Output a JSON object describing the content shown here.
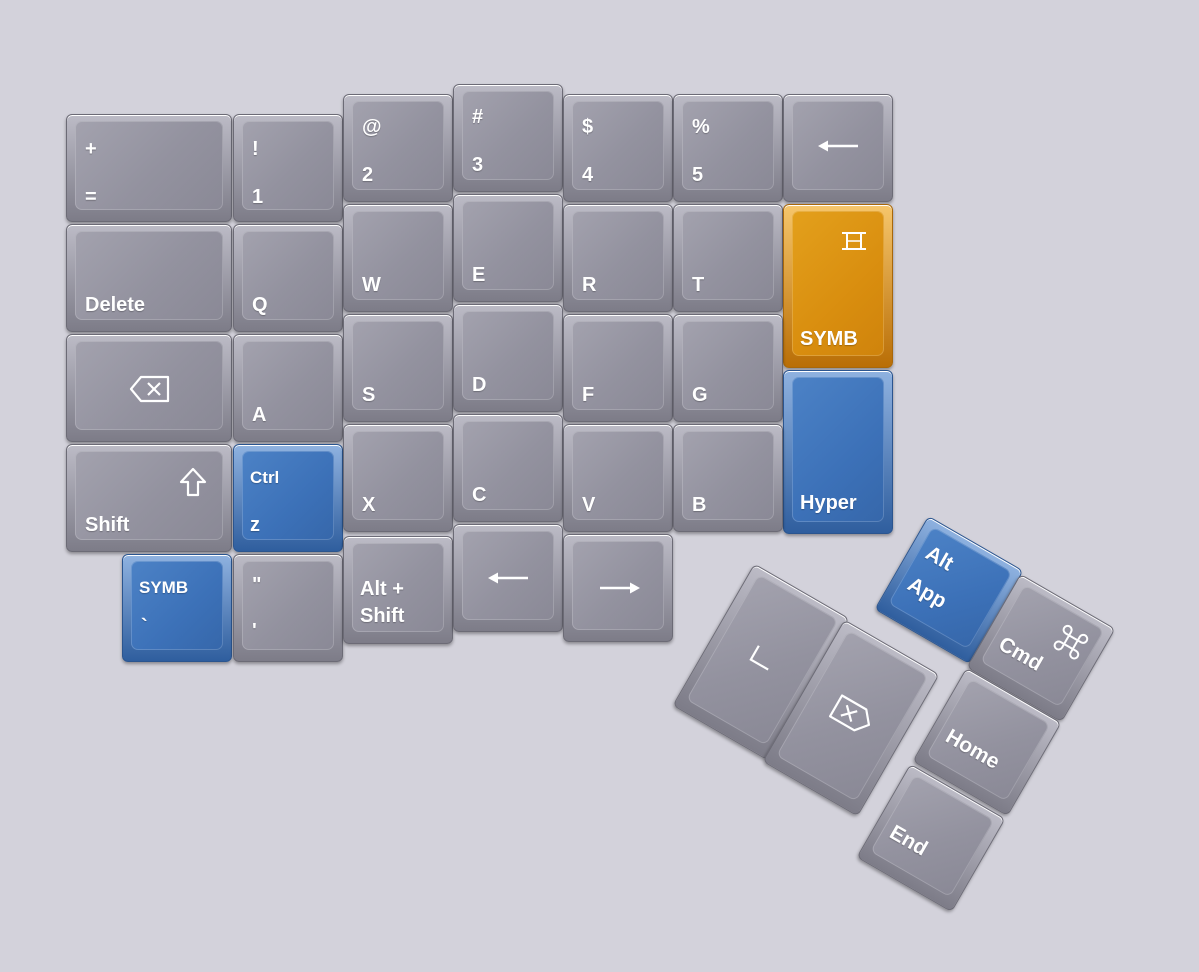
{
  "keyboard": {
    "accent_colors": {
      "blue": "#3f74bb",
      "orange": "#dd9316",
      "key_gray": "#9796a3",
      "background": "#d3d2db"
    },
    "keys": {
      "eq": {
        "top": "+",
        "bottom": "="
      },
      "one": {
        "top": "!",
        "bottom": "1"
      },
      "two": {
        "top": "@",
        "bottom": "2"
      },
      "three": {
        "top": "#",
        "bottom": "3"
      },
      "four": {
        "top": "$",
        "bottom": "4"
      },
      "five": {
        "top": "%",
        "bottom": "5"
      },
      "delete": "Delete",
      "q": "Q",
      "w": "W",
      "e": "E",
      "r": "R",
      "t": "T",
      "a": "A",
      "s": "S",
      "d": "D",
      "f": "F",
      "g": "G",
      "shift": "Shift",
      "ctrl_z": {
        "top": "Ctrl",
        "bottom": "z"
      },
      "x": "X",
      "c": "C",
      "v": "V",
      "b": "B",
      "symb_layer": "SYMB",
      "hyper": "Hyper",
      "symb_grave": {
        "top": "SYMB",
        "bottom": "`"
      },
      "quote": {
        "top": "\"",
        "bottom": "'"
      },
      "alt_shift": {
        "line1": "Alt +",
        "line2": "Shift"
      },
      "alt_app": {
        "top": "Alt",
        "bottom": "App"
      },
      "cmd": "Cmd",
      "home": "Home",
      "end": "End"
    },
    "icons": {
      "top_arrow": "left-arrow-icon",
      "backspace": "backspace-icon",
      "shift": "shift-arrow-icon",
      "layer_toggle": "layer-toggle-icon",
      "arrow_left": "left-arrow-icon",
      "arrow_right": "right-arrow-icon",
      "space": "space-icon",
      "forward_delete": "forward-delete-icon",
      "command": "command-icon"
    }
  }
}
